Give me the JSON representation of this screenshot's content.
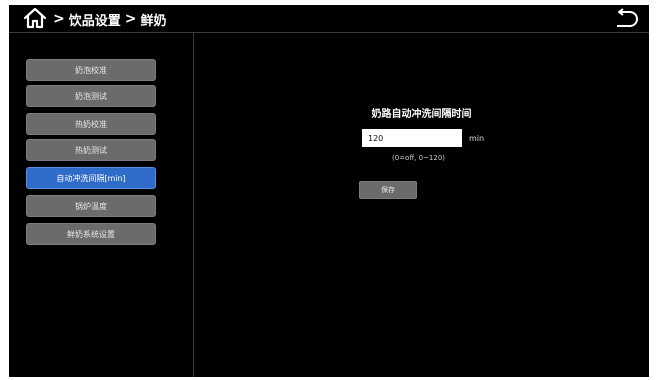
{
  "header": {
    "breadcrumb": [
      "饮品设置",
      "鲜奶"
    ],
    "home_icon": "home-icon",
    "back_icon": "back-arrow-icon"
  },
  "sidebar": {
    "items": [
      {
        "label": "奶泡校准",
        "active": false
      },
      {
        "label": "奶泡测试",
        "active": false
      },
      {
        "label": "热奶校准",
        "active": false
      },
      {
        "label": "热奶测试",
        "active": false
      },
      {
        "label": "自动冲洗间隔[min]",
        "active": true
      },
      {
        "label": "锅炉温度",
        "active": false
      },
      {
        "label": "鲜奶系统设置",
        "active": false
      }
    ]
  },
  "main": {
    "title": "奶路自动冲洗间隔时间",
    "value": "120",
    "unit": "min",
    "hint": "(0=off, 0~120)",
    "save_label": "保存"
  },
  "colors": {
    "background": "#000000",
    "button_gray": "#6b6b6b",
    "button_active": "#2f6cc9"
  }
}
